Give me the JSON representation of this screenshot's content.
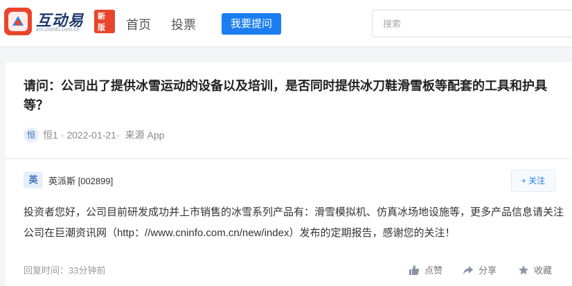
{
  "header": {
    "logo_text": "互动易",
    "logo_sub": "irm.cninfo.com.cn",
    "logo_badge": "新版",
    "nav": {
      "home": "首页",
      "vote": "投票"
    },
    "ask_button": "我要提问",
    "search_placeholder": "搜索"
  },
  "question": {
    "title": "请问：公司出了提供冰雪运动的设备以及培训，是否同时提供冰刀鞋滑雪板等配套的工具和护具等？",
    "author_avatar": "恒",
    "author": "恒1",
    "date": " · 2022-01-21·",
    "source": "来源 App"
  },
  "answer": {
    "company_avatar": "英",
    "company": "英派斯 [002899]",
    "follow_label": "+ 关注",
    "body": "投资者您好，公司目前研发成功并上市销售的冰雪系列产品有：滑雪模拟机、仿真冰场地设施等，更多产品信息请关注公司在巨潮资讯网（http：//www.cninfo.com.cn/new/index）发布的定期报告，感谢您的关注！",
    "reply_time": "回复时间：33分钟前",
    "actions": {
      "like": "点赞",
      "share": "分享",
      "favorite": "收藏"
    }
  },
  "colors": {
    "brand_blue": "#1a7ef0",
    "logo_red": "#e8452c"
  }
}
